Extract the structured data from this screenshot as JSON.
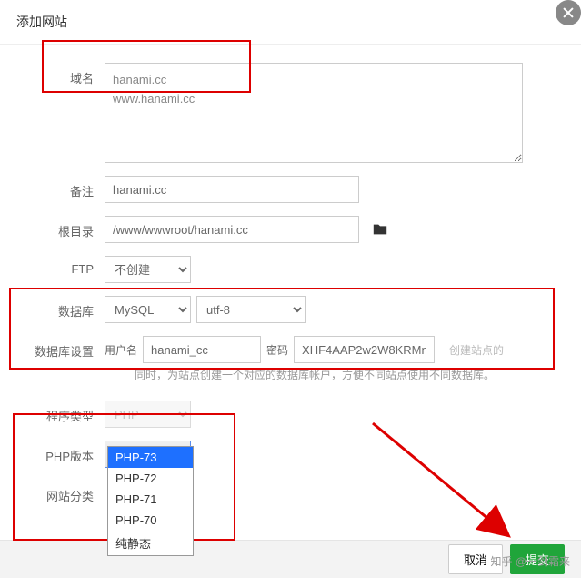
{
  "header": {
    "title": "添加网站"
  },
  "fields": {
    "domain_label": "域名",
    "domain_value": "hanami.cc\nwww.hanami.cc",
    "remark_label": "备注",
    "remark_value": "hanami.cc",
    "root_label": "根目录",
    "root_value": "/www/wwwroot/hanami.cc",
    "ftp_label": "FTP",
    "ftp_value": "不创建",
    "db_label": "数据库",
    "db_type": "MySQL",
    "db_charset": "utf-8",
    "dbset_label": "数据库设置",
    "dbset_user_label": "用户名",
    "dbset_user_value": "hanami_cc",
    "dbset_pass_label": "密码",
    "dbset_pass_value": "XHF4AAP2w2W8KRMn",
    "dbset_hint_side": "创建站点的",
    "dbset_hint_line": "同时，为站点创建一个对应的数据库帐户，方便不同站点使用不同数据库。",
    "type_label": "程序类型",
    "type_value": "PHP",
    "php_label": "PHP版本",
    "php_value": "PHP-73",
    "category_label": "网站分类"
  },
  "php_options": [
    "PHP-73",
    "PHP-72",
    "PHP-71",
    "PHP-70",
    "纯静态"
  ],
  "php_selected": "PHP-73",
  "footer": {
    "cancel": "取消",
    "submit": "提交"
  },
  "watermark": "知乎 @一剑霜来"
}
